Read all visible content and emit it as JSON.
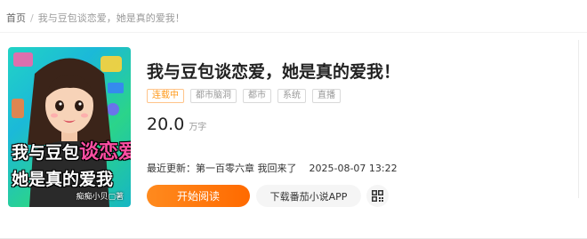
{
  "breadcrumb": {
    "home": "首页",
    "separator": "/",
    "current": "我与豆包谈恋爱，她是真的爱我！"
  },
  "book": {
    "title": "我与豆包谈恋爱，她是真的爱我！",
    "cover": {
      "title_line1_pre": "我与豆包",
      "title_line1_accent": "谈恋爱",
      "title_line2": "她是真的爱我",
      "author_sign": "痴痴小贝▢著"
    },
    "tags": [
      "连载中",
      "都市脑洞",
      "都市",
      "系统",
      "直播"
    ],
    "word_count": "20.0",
    "word_unit": "万字",
    "latest_label": "最近更新：",
    "latest_chapter": "第一百零六章 我回来了",
    "latest_time": "2025-08-07 13:22"
  },
  "actions": {
    "read_label": "开始阅读",
    "download_label": "下载番茄小说APP",
    "qr_icon": "qr-code-icon"
  },
  "colors": {
    "accent": "#ff7a10",
    "status_tag": "#ff9a1b",
    "muted": "#999999"
  }
}
